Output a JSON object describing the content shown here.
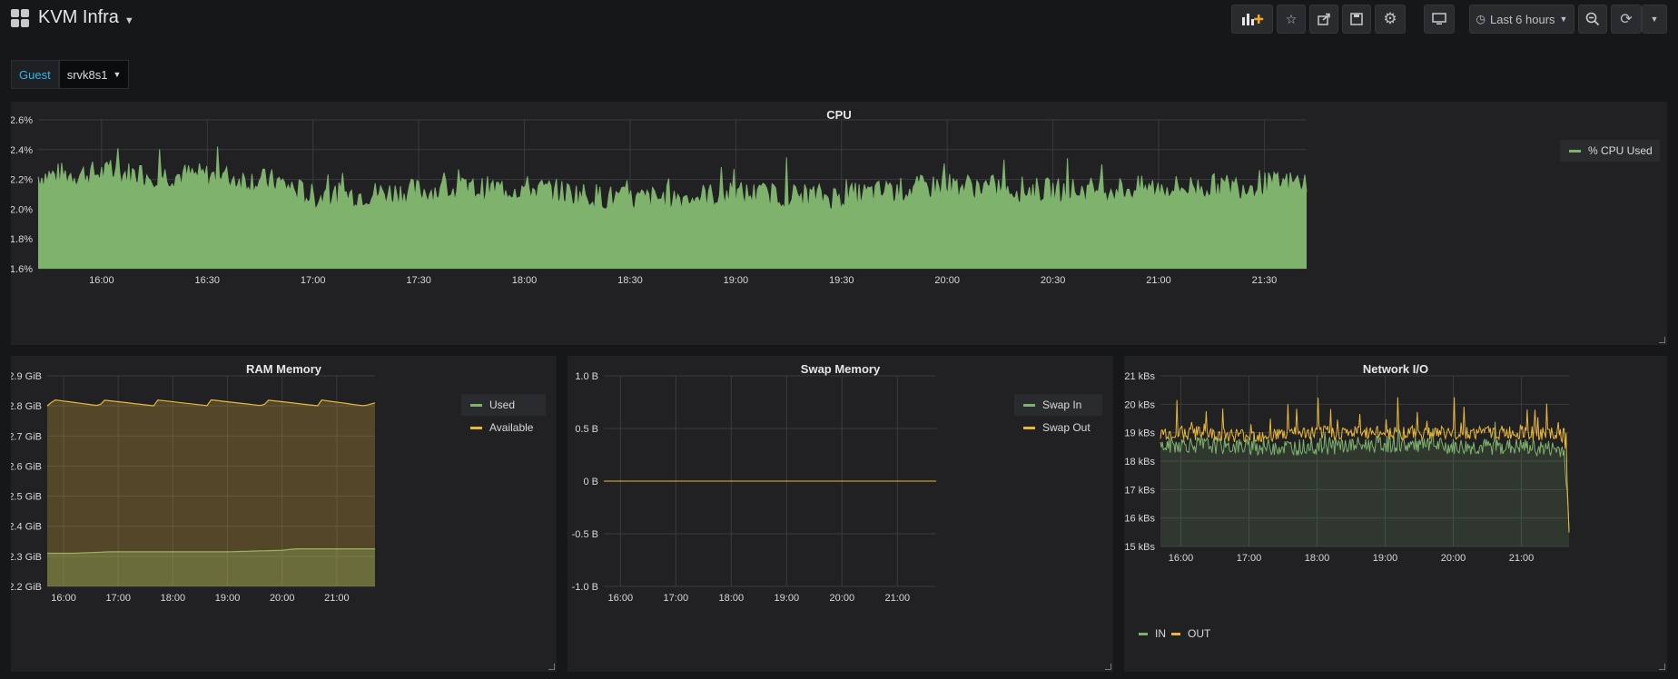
{
  "dashboard": {
    "title": "KVM Infra"
  },
  "toolbar": {
    "time_range": "Last 6 hours"
  },
  "variable": {
    "label": "Guest",
    "value": "srvk8s1"
  },
  "colors": {
    "green": "#7eb26d",
    "yellow": "#eab839",
    "background": "#161719",
    "panel": "#212124"
  },
  "icons": [
    "dashboard-grid-icon",
    "add-panel-icon",
    "star-icon",
    "share-icon",
    "save-icon",
    "gear-icon",
    "tv-icon",
    "clock-icon",
    "zoom-out-icon",
    "refresh-icon",
    "chevron-down-icon"
  ],
  "panels": {
    "cpu": {
      "title": "CPU",
      "legend": [
        "% CPU Used"
      ]
    },
    "ram": {
      "title": "RAM Memory",
      "legend": [
        "Used",
        "Available"
      ]
    },
    "swap": {
      "title": "Swap Memory",
      "legend": [
        "Swap In",
        "Swap Out"
      ]
    },
    "net": {
      "title": "Network I/O",
      "legend": [
        "IN",
        "OUT"
      ]
    }
  },
  "chart_data": [
    {
      "type": "area",
      "title": "CPU",
      "x_ticks": [
        "16:00",
        "16:30",
        "17:00",
        "17:30",
        "18:00",
        "18:30",
        "19:00",
        "19:30",
        "20:00",
        "20:30",
        "21:00",
        "21:30"
      ],
      "y_ticks": [
        "1.6%",
        "1.8%",
        "2.0%",
        "2.2%",
        "2.4%",
        "2.6%"
      ],
      "ylim": [
        1.6,
        2.6
      ],
      "x_range": [
        "15:42",
        "21:42"
      ],
      "series": [
        {
          "name": "% CPU Used",
          "color": "#7eb26d",
          "x": [
            "15:42",
            "16:00",
            "16:30",
            "16:50",
            "17:00",
            "17:30",
            "18:00",
            "18:30",
            "19:00",
            "19:30",
            "20:00",
            "20:30",
            "21:00",
            "21:30",
            "21:42"
          ],
          "values": [
            2.22,
            2.24,
            2.22,
            2.18,
            2.08,
            2.12,
            2.14,
            2.06,
            2.1,
            2.08,
            2.16,
            2.12,
            2.14,
            2.16,
            2.18
          ]
        }
      ],
      "legend_position": "right",
      "grid": true
    },
    {
      "type": "area",
      "title": "RAM Memory",
      "x_ticks": [
        "16:00",
        "17:00",
        "18:00",
        "19:00",
        "20:00",
        "21:00"
      ],
      "y_ticks": [
        "2.2 GiB",
        "2.3 GiB",
        "2.4 GiB",
        "2.5 GiB",
        "2.6 GiB",
        "2.7 GiB",
        "2.8 GiB",
        "2.9 GiB"
      ],
      "ylim": [
        2.2,
        2.9
      ],
      "x_range": [
        "15:42",
        "21:42"
      ],
      "series": [
        {
          "name": "Used",
          "color": "#7eb26d",
          "x": [
            "15:42",
            "16:10",
            "16:50",
            "17:30",
            "18:00",
            "19:00",
            "20:00",
            "20:15",
            "21:00",
            "21:42"
          ],
          "values": [
            2.31,
            2.31,
            2.315,
            2.315,
            2.315,
            2.315,
            2.32,
            2.325,
            2.325,
            2.325
          ]
        },
        {
          "name": "Available",
          "color": "#eab839",
          "x": [
            "15:42",
            "15:50",
            "16:40",
            "16:42",
            "17:40",
            "17:42",
            "18:40",
            "18:42",
            "19:40",
            "19:42",
            "20:40",
            "20:42",
            "21:30",
            "21:42"
          ],
          "values": [
            2.8,
            2.82,
            2.8,
            2.82,
            2.8,
            2.82,
            2.8,
            2.82,
            2.8,
            2.82,
            2.8,
            2.82,
            2.8,
            2.81
          ]
        }
      ],
      "legend_position": "right",
      "grid": true
    },
    {
      "type": "line",
      "title": "Swap Memory",
      "x_ticks": [
        "16:00",
        "17:00",
        "18:00",
        "19:00",
        "20:00",
        "21:00"
      ],
      "y_ticks": [
        "-1.0 B",
        "-0.5 B",
        "0 B",
        "0.5 B",
        "1.0 B"
      ],
      "ylim": [
        -1.0,
        1.0
      ],
      "x_range": [
        "15:42",
        "21:42"
      ],
      "series": [
        {
          "name": "Swap In",
          "color": "#7eb26d",
          "x": [
            "15:42",
            "21:42"
          ],
          "values": [
            0,
            0
          ]
        },
        {
          "name": "Swap Out",
          "color": "#eab839",
          "x": [
            "15:42",
            "21:42"
          ],
          "values": [
            0,
            0
          ]
        }
      ],
      "legend_position": "right",
      "grid": true
    },
    {
      "type": "line",
      "title": "Network I/O",
      "x_ticks": [
        "16:00",
        "17:00",
        "18:00",
        "19:00",
        "20:00",
        "21:00"
      ],
      "y_ticks": [
        "15 kBs",
        "16 kBs",
        "17 kBs",
        "18 kBs",
        "19 kBs",
        "20 kBs",
        "21 kBs"
      ],
      "ylim": [
        15,
        21
      ],
      "x_range": [
        "15:42",
        "21:42"
      ],
      "series": [
        {
          "name": "IN",
          "color": "#7eb26d",
          "x": [
            "15:42",
            "16:00",
            "17:00",
            "18:00",
            "19:00",
            "20:00",
            "21:00",
            "21:38",
            "21:42"
          ],
          "values": [
            18.5,
            18.6,
            18.5,
            18.5,
            18.6,
            18.5,
            18.5,
            18.4,
            15.5
          ]
        },
        {
          "name": "OUT",
          "color": "#eab839",
          "x": [
            "15:42",
            "16:00",
            "17:00",
            "18:00",
            "19:00",
            "20:00",
            "21:00",
            "21:38",
            "21:42"
          ],
          "values": [
            19.0,
            19.0,
            18.9,
            19.0,
            19.0,
            19.0,
            19.0,
            18.9,
            15.7
          ]
        }
      ],
      "legend_position": "bottom",
      "grid": true
    }
  ]
}
